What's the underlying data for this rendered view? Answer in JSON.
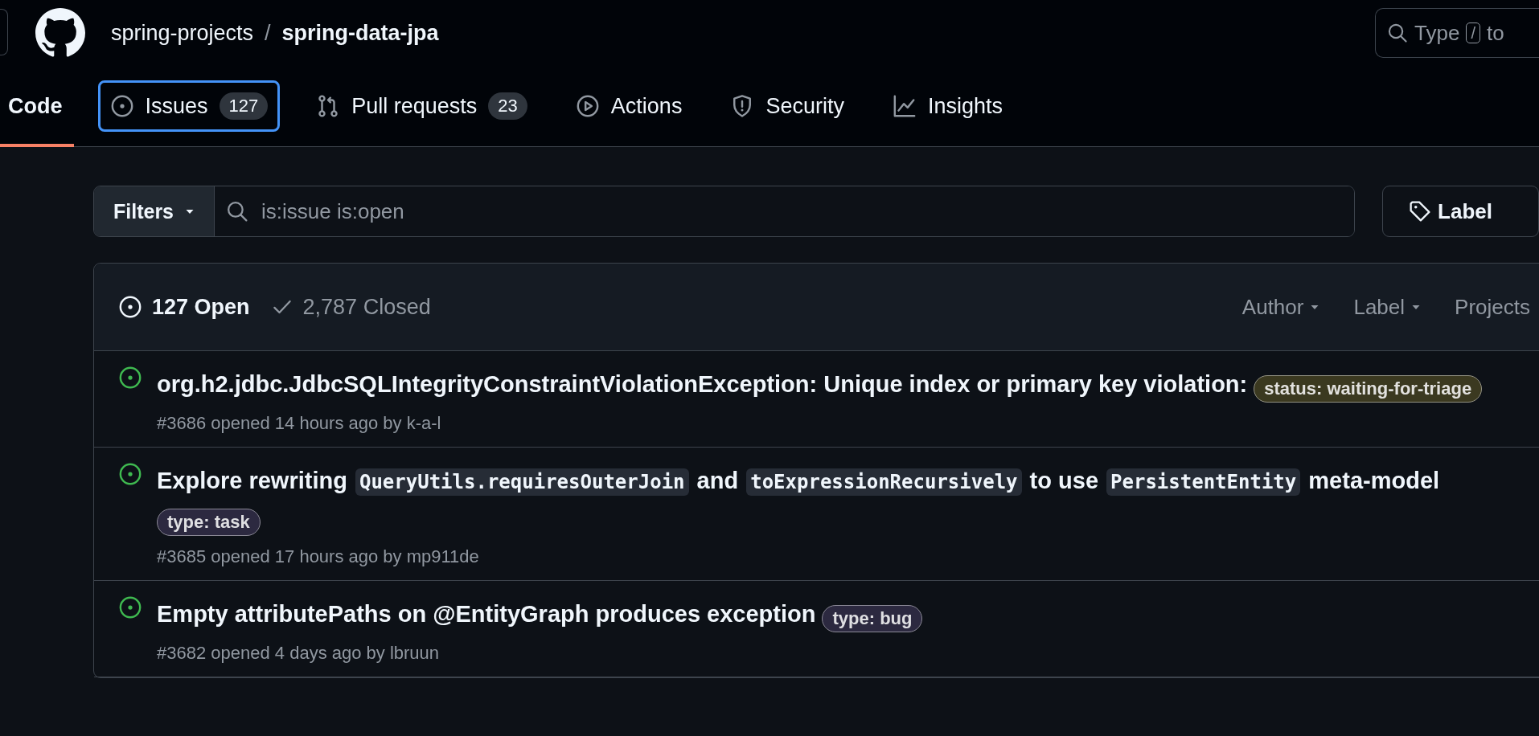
{
  "header": {
    "owner": "spring-projects",
    "separator": "/",
    "repo": "spring-data-jpa",
    "search": {
      "placeholder_start": "Type",
      "key": "/",
      "placeholder_end": "to"
    }
  },
  "tabs": [
    {
      "label": "Code",
      "kind": "code",
      "selected": true,
      "focused": false
    },
    {
      "label": "Issues",
      "kind": "issues",
      "count": "127",
      "selected": false,
      "focused": true
    },
    {
      "label": "Pull requests",
      "kind": "pulls",
      "count": "23",
      "selected": false,
      "focused": false
    },
    {
      "label": "Actions",
      "kind": "actions",
      "selected": false,
      "focused": false
    },
    {
      "label": "Security",
      "kind": "security",
      "selected": false,
      "focused": false
    },
    {
      "label": "Insights",
      "kind": "insights",
      "selected": false,
      "focused": false
    }
  ],
  "filter_bar": {
    "filters_label": "Filters",
    "query": "is:issue is:open",
    "labels_button": "Label"
  },
  "list_header": {
    "states": [
      {
        "label": "127 Open",
        "kind": "open",
        "selected": true
      },
      {
        "label": "2,787 Closed",
        "kind": "closed",
        "selected": false
      }
    ],
    "dropdowns": [
      {
        "label": "Author",
        "caret": true
      },
      {
        "label": "Label",
        "caret": true
      },
      {
        "label": "Projects",
        "caret": false
      }
    ]
  },
  "issues": [
    {
      "title": [
        {
          "kind": "text",
          "text": "org.h2.jdbc.JdbcSQLIntegrityConstraintViolationException: Unique index or primary key violation:"
        }
      ],
      "labels": [
        {
          "name": "status: waiting-for-triage",
          "color": "#3b3920"
        }
      ],
      "meta": "#3686 opened 14 hours ago by k-a-l"
    },
    {
      "title": [
        {
          "kind": "text",
          "text": "Explore rewriting "
        },
        {
          "kind": "code",
          "text": "QueryUtils.requiresOuterJoin"
        },
        {
          "kind": "text",
          "text": " and "
        },
        {
          "kind": "code",
          "text": "toExpressionRecursively"
        },
        {
          "kind": "text",
          "text": " to use "
        },
        {
          "kind": "code",
          "text": "PersistentEntity"
        },
        {
          "kind": "text",
          "text": " meta-model"
        }
      ],
      "labels": [
        {
          "name": "type: task",
          "color": "#2c2940"
        }
      ],
      "meta": "#3685 opened 17 hours ago by mp911de"
    },
    {
      "title": [
        {
          "kind": "text",
          "text": "Empty attributePaths on @EntityGraph produces exception"
        }
      ],
      "labels": [
        {
          "name": "type: bug",
          "color": "#2c2940"
        }
      ],
      "meta": "#3682 opened 4 days ago by lbruun"
    }
  ]
}
